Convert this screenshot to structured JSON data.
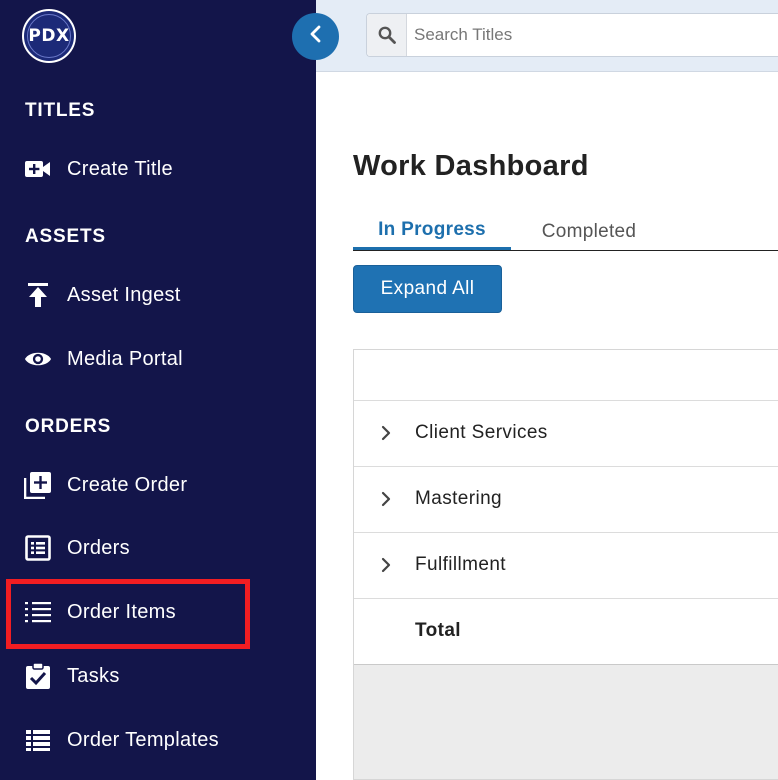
{
  "app": {
    "logo_text": "PDX"
  },
  "sidebar": {
    "sections": [
      {
        "title": "TITLES",
        "items": [
          {
            "label": "Create Title",
            "icon": "video-plus-icon"
          }
        ]
      },
      {
        "title": "ASSETS",
        "items": [
          {
            "label": "Asset Ingest",
            "icon": "upload-icon"
          },
          {
            "label": "Media Portal",
            "icon": "eye-icon"
          }
        ]
      },
      {
        "title": "ORDERS",
        "items": [
          {
            "label": "Create Order",
            "icon": "add-box-icon"
          },
          {
            "label": "Orders",
            "icon": "list-box-icon"
          },
          {
            "label": "Order Items",
            "icon": "numbered-list-icon",
            "highlighted": true
          },
          {
            "label": "Tasks",
            "icon": "clipboard-check-icon"
          },
          {
            "label": "Order Templates",
            "icon": "table-list-icon"
          }
        ]
      }
    ],
    "highlight_color": "#f21d22",
    "background_color": "#13154a"
  },
  "search": {
    "placeholder": "Search Titles",
    "value": ""
  },
  "main": {
    "title": "Work Dashboard",
    "tabs": [
      {
        "label": "In Progress",
        "active": true
      },
      {
        "label": "Completed",
        "active": false
      }
    ],
    "expand_button": "Expand All",
    "table": {
      "rows": [
        {
          "label": "Client Services",
          "expandable": true
        },
        {
          "label": "Mastering",
          "expandable": true
        },
        {
          "label": "Fulfillment",
          "expandable": true
        },
        {
          "label": "Total",
          "expandable": false
        }
      ]
    }
  },
  "colors": {
    "accent": "#1f72b3",
    "topbar": "#e4ecf6"
  }
}
